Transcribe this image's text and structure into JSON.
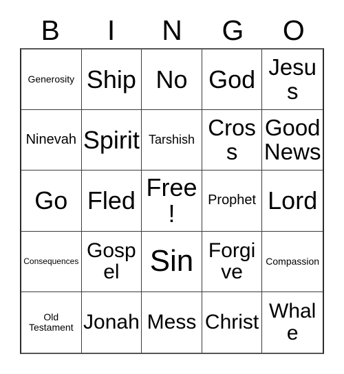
{
  "card": {
    "title": "BINGO",
    "header_letters": [
      "B",
      "I",
      "N",
      "G",
      "O"
    ],
    "free_space_label": "Free!",
    "colors": {
      "background": "#ffffff",
      "grid_line": "#3a3a3a",
      "border": "#2b2b2b",
      "text": "#000000"
    },
    "grid": {
      "columns": 5,
      "rows": 5,
      "cells": [
        {
          "text": "Generosity",
          "size": "s-xxs"
        },
        {
          "text": "Ship",
          "size": "s-xl"
        },
        {
          "text": "No",
          "size": "s-xl"
        },
        {
          "text": "God",
          "size": "s-xl"
        },
        {
          "text": "Jesus",
          "size": "s-lg"
        },
        {
          "text": "Ninevah",
          "size": "s-sm"
        },
        {
          "text": "Spirit",
          "size": "s-xl"
        },
        {
          "text": "Tarshish",
          "size": "s-xs"
        },
        {
          "text": "Cross",
          "size": "s-lg"
        },
        {
          "text": "Good News",
          "size": "s-lg"
        },
        {
          "text": "Go",
          "size": "s-xl"
        },
        {
          "text": "Fled",
          "size": "s-xl"
        },
        {
          "text": "Free!",
          "size": "s-xl"
        },
        {
          "text": "Prophet",
          "size": "s-sm"
        },
        {
          "text": "Lord",
          "size": "s-xl"
        },
        {
          "text": "Consequences",
          "size": "s-tiny"
        },
        {
          "text": "Gospel",
          "size": "s-md"
        },
        {
          "text": "Sin",
          "size": "s-xxl"
        },
        {
          "text": "Forgive",
          "size": "s-md"
        },
        {
          "text": "Compassion",
          "size": "s-xxs"
        },
        {
          "text": "Old Testament",
          "size": "s-xxs"
        },
        {
          "text": "Jonah",
          "size": "s-md"
        },
        {
          "text": "Mess",
          "size": "s-md"
        },
        {
          "text": "Christ",
          "size": "s-md"
        },
        {
          "text": "Whale",
          "size": "s-md"
        }
      ]
    }
  }
}
